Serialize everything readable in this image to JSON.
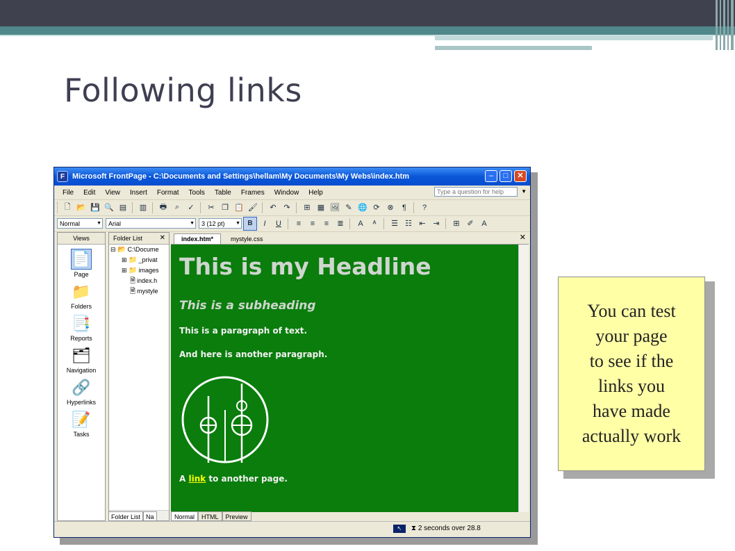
{
  "slide": {
    "title": "Following links",
    "callout_text": "You can test\nyour page\nto see if the\nlinks you\nhave made\nactually work"
  },
  "window": {
    "title": "Microsoft FrontPage - C:\\Documents and Settings\\hellam\\My Documents\\My Webs\\index.htm",
    "app_icon": "frontpage-icon",
    "menu": [
      "File",
      "Edit",
      "View",
      "Insert",
      "Format",
      "Tools",
      "Table",
      "Frames",
      "Window",
      "Help"
    ],
    "ask_placeholder": "Type a question for help",
    "format": {
      "style": "Normal",
      "font": "Arial",
      "size": "3 (12 pt)",
      "bold": "B",
      "italic": "I",
      "underline": "U"
    },
    "views_header": "Views",
    "views": [
      "Page",
      "Folders",
      "Reports",
      "Navigation",
      "Hyperlinks",
      "Tasks"
    ],
    "folder_list": {
      "header": "Folder List",
      "items": [
        {
          "label": "C:\\Docume",
          "toggle": "⊟"
        },
        {
          "label": "_privat",
          "toggle": "⊞"
        },
        {
          "label": "images",
          "toggle": "⊞"
        },
        {
          "label": "index.h",
          "toggle": ""
        },
        {
          "label": "mystyle",
          "toggle": ""
        }
      ],
      "bottom_tabs": [
        "Folder List",
        "Na"
      ]
    },
    "doc_tabs": [
      "index.htm*",
      "mystyle.css"
    ],
    "page": {
      "headline": "This is my Headline",
      "subheading": "This is a subheading",
      "paragraph1": "This is a paragraph of text.",
      "paragraph2": "And here is another paragraph.",
      "link_prefix": "A ",
      "link_text": "link",
      "link_suffix": " to another page.",
      "background": "#0a7d0c"
    },
    "view_tabs": [
      "Normal",
      "HTML",
      "Preview"
    ],
    "status": "2 seconds over 28.8"
  },
  "colors": {
    "header_dark": "#40414f",
    "header_teal": "#4f878a",
    "title_text": "#3f3f52",
    "callout_bg": "#ffffa6",
    "xp_blue": "#0a57d8"
  }
}
